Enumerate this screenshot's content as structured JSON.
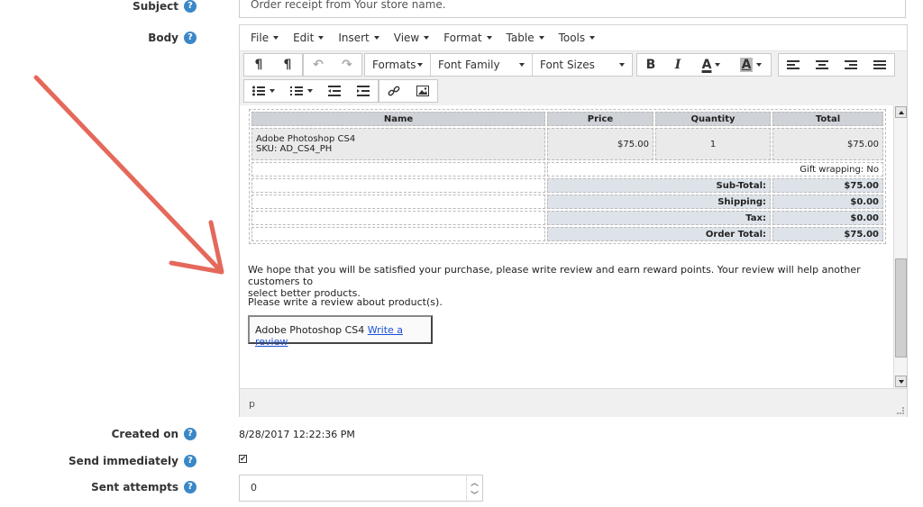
{
  "form": {
    "subject_label": "Subject",
    "subject_value": "Order receipt from Your store name.",
    "body_label": "Body",
    "created_label": "Created on",
    "created_value": "8/28/2017 12:22:36 PM",
    "send_label": "Send immediately",
    "send_checked": "✔",
    "attempts_label": "Sent attempts",
    "attempts_value": "0"
  },
  "menubar": [
    "File",
    "Edit",
    "Insert",
    "View",
    "Format",
    "Table",
    "Tools"
  ],
  "toolbar": {
    "formats": "Formats",
    "font_family": "Font Family",
    "font_sizes": "Font Sizes"
  },
  "icons": [
    "ltr-icon",
    "rtl-icon",
    "undo-icon",
    "redo-icon",
    "bold-icon",
    "italic-icon",
    "text-color-icon",
    "background-color-icon",
    "align-left-icon",
    "align-center-icon",
    "align-right-icon",
    "justify-icon",
    "bullet-list-icon",
    "numbered-list-icon",
    "outdent-icon",
    "indent-icon",
    "link-icon",
    "image-icon",
    "help-icon"
  ],
  "order": {
    "headers": [
      "Name",
      "Price",
      "Quantity",
      "Total"
    ],
    "item": {
      "name": "Adobe Photoshop CS4",
      "sku": "SKU: AD_CS4_PH",
      "price": "$75.00",
      "quantity": "1",
      "total": "$75.00"
    },
    "gift": "Gift wrapping: No",
    "subtotal_label": "Sub-Total:",
    "subtotal": "$75.00",
    "shipping_label": "Shipping:",
    "shipping": "$0.00",
    "tax_label": "Tax:",
    "tax": "$0.00",
    "total_label": "Order Total:",
    "total": "$75.00"
  },
  "body_text": {
    "line1": "We hope that you will be satisfied your purchase, please write review and earn reward points. Your review will help another customers to",
    "line2": "select better products.",
    "line3": "Please write a review about product(s).",
    "review_product": "Adobe Photoshop CS4",
    "review_link": "Write a review"
  },
  "status_path": "p",
  "colors": {
    "help": "#3a87c8",
    "annotation_arrow": "#e5695b",
    "link": "#1a4fd6"
  }
}
